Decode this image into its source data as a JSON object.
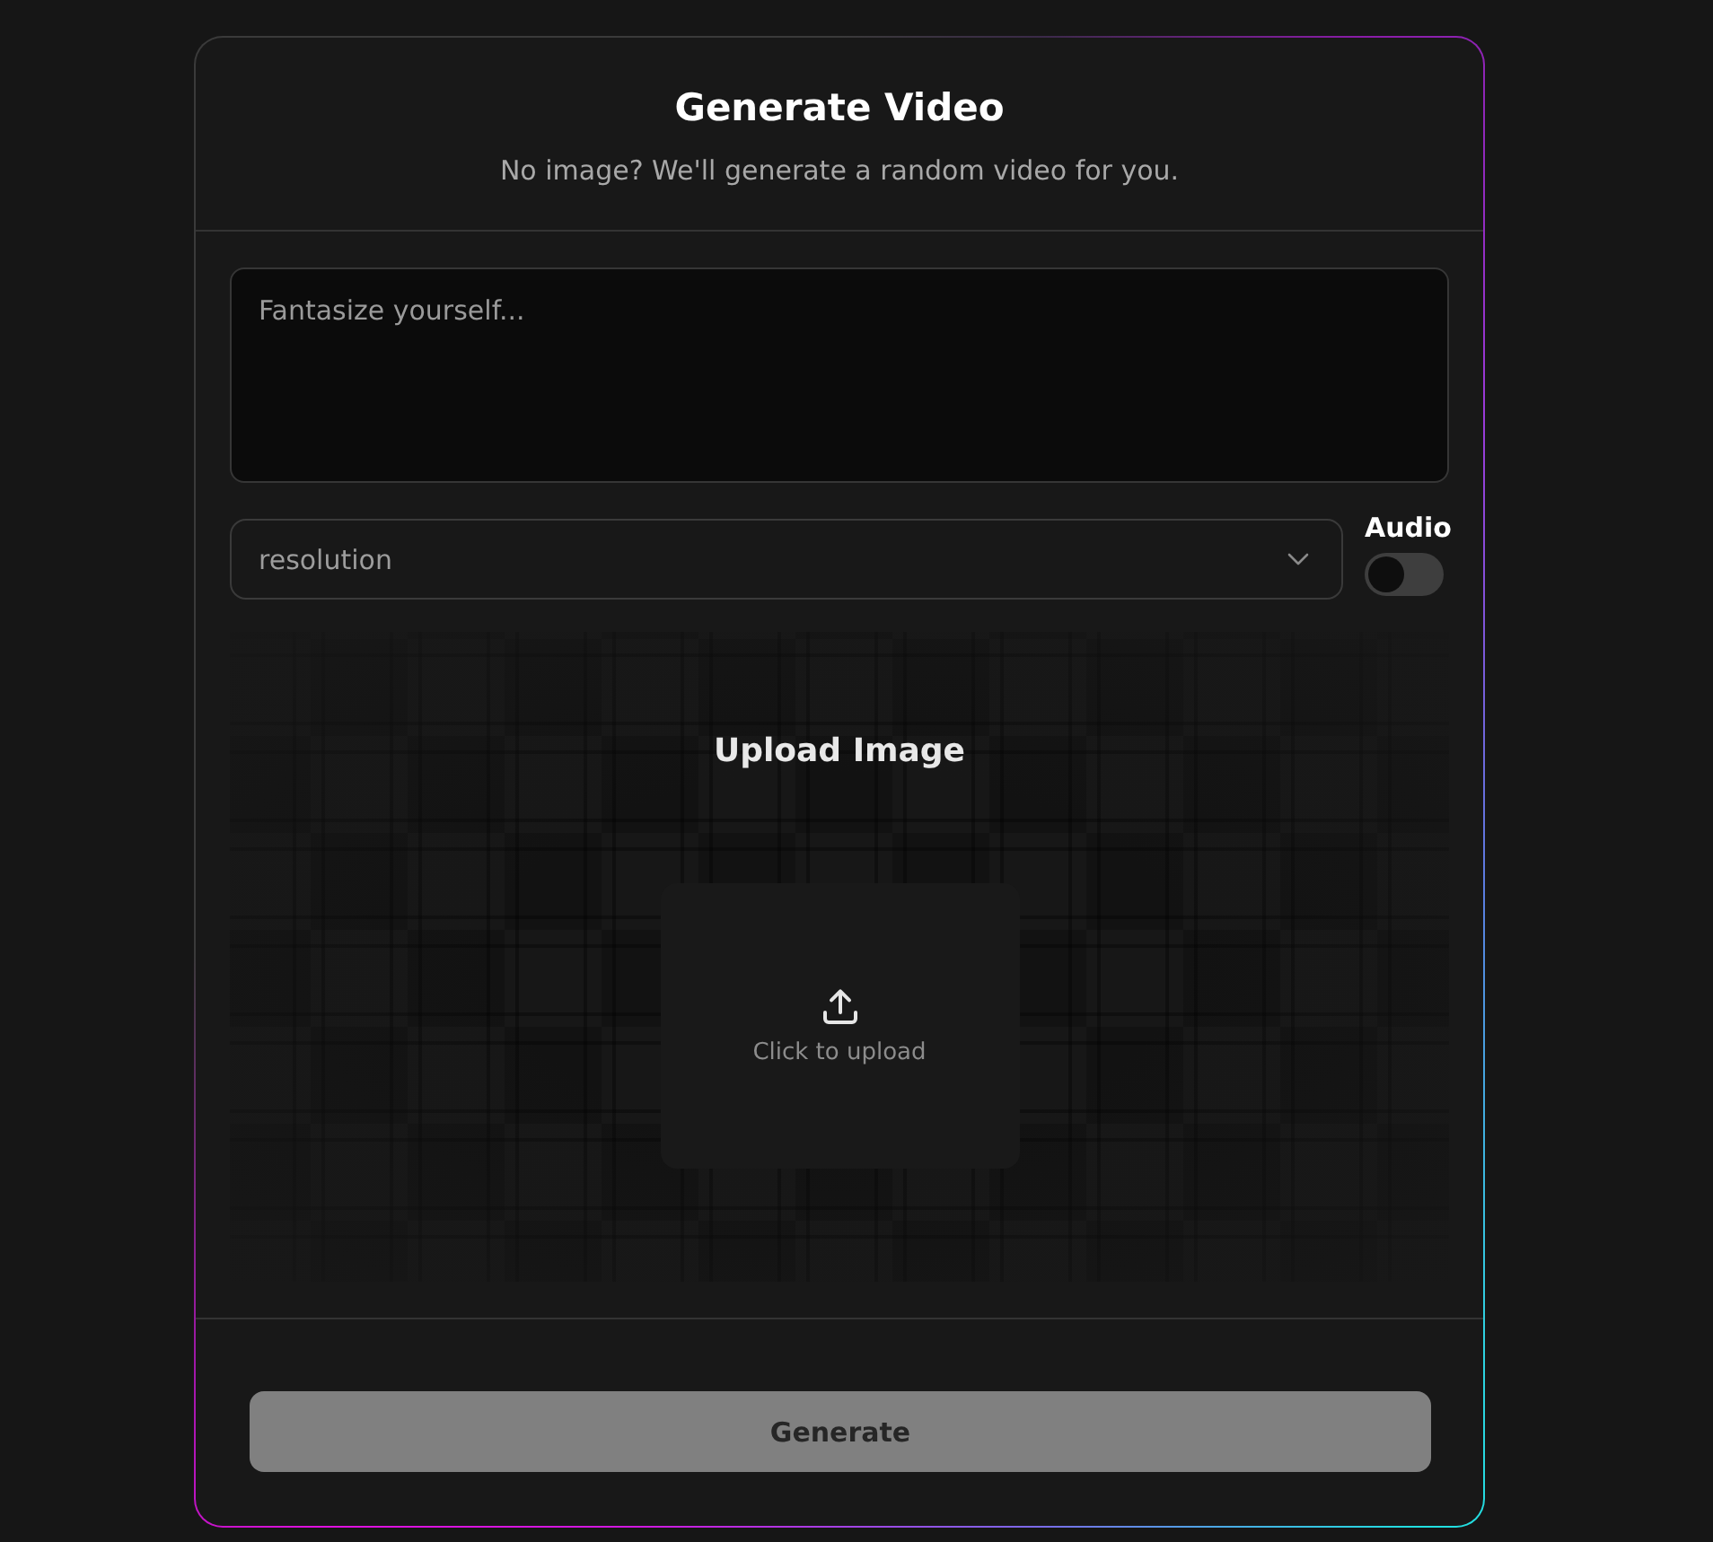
{
  "dialog": {
    "title": "Generate Video",
    "subtitle": "No image? We'll generate a random video for you."
  },
  "prompt": {
    "placeholder": "Fantasize yourself..."
  },
  "resolution": {
    "placeholder": "resolution"
  },
  "audio": {
    "label": "Audio",
    "on": false
  },
  "upload": {
    "title": "Upload Image",
    "hint": "Click to upload"
  },
  "generate_button": {
    "label": "Generate",
    "disabled": true
  }
}
